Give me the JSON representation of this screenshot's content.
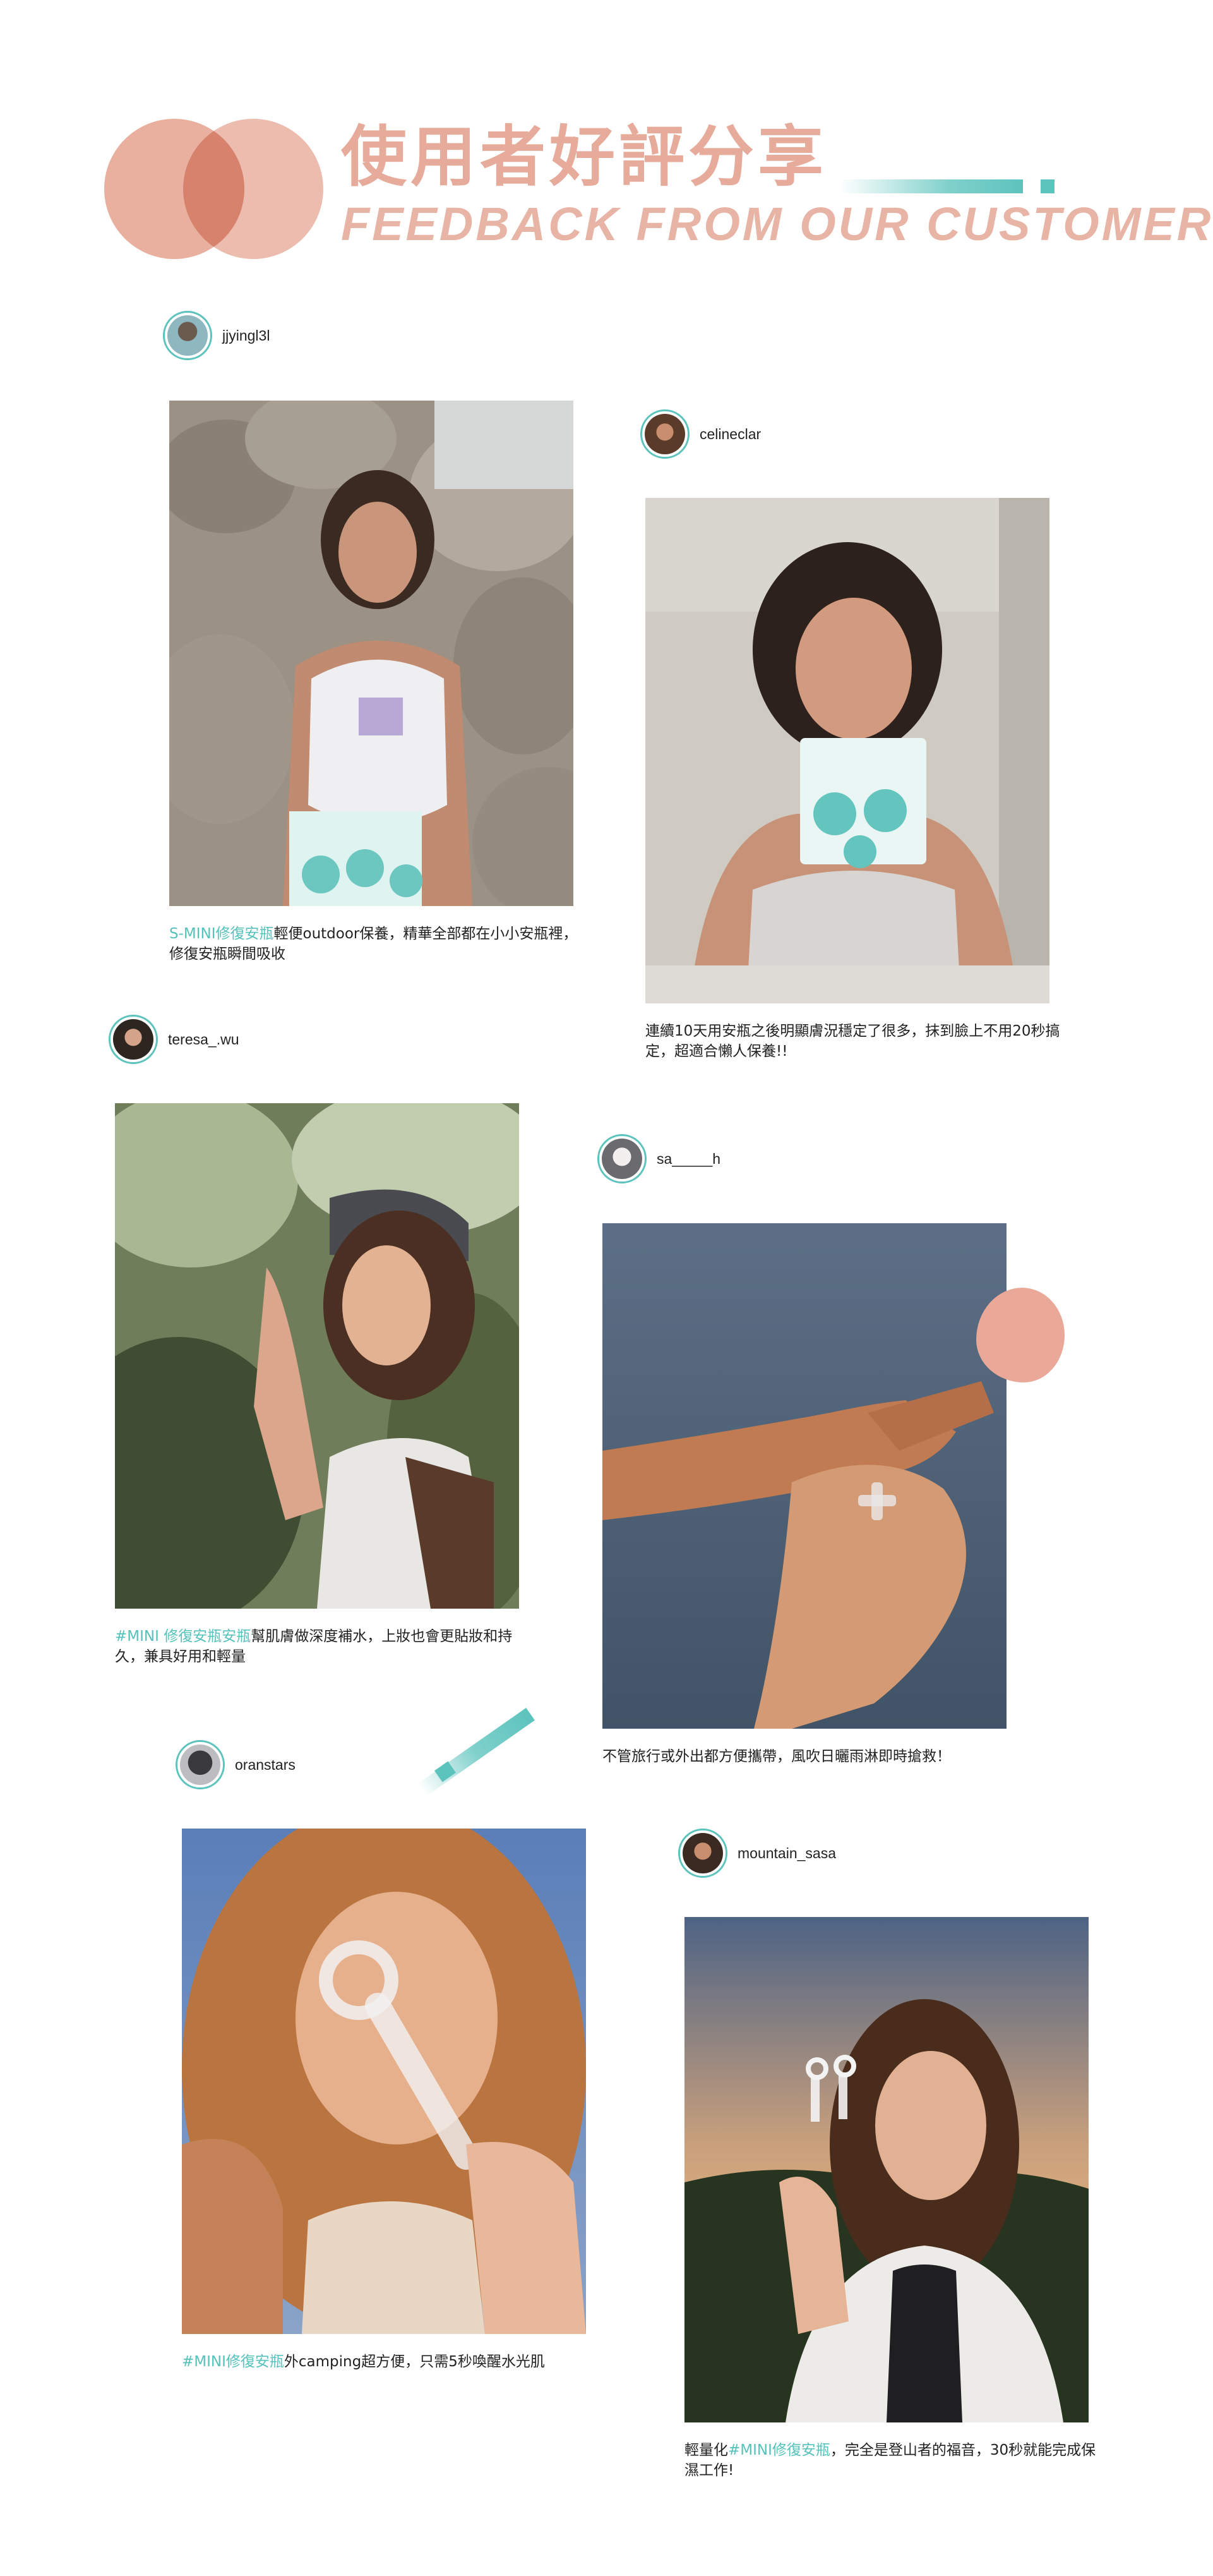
{
  "header": {
    "title_zh": "使用者好評分享",
    "title_en": "FEEDBACK FROM OUR CUSTOMER"
  },
  "colors": {
    "accent_pink": "#e6ab9a",
    "accent_teal": "#5dc3bd"
  },
  "posts": [
    {
      "username": "jjyingl3l",
      "caption_hl": "S-MINI修復安瓶",
      "caption_rest": "輕便outdoor保養，精華全部都在小小安瓶裡，修復安瓶瞬間吸收"
    },
    {
      "username": "celineclar",
      "caption_hl": "",
      "caption_rest": "連續10天用安瓶之後明顯膚況穩定了很多，抹到臉上不用20秒搞定，超適合懶人保養!!"
    },
    {
      "username": "teresa_.wu",
      "caption_hl": "#MINI 修復安瓶安瓶",
      "caption_rest": "幫肌膚做深度補水，上妝也會更貼妝和持久，兼具好用和輕量"
    },
    {
      "username": "sa_____h",
      "caption_hl": "",
      "caption_rest": "不管旅行或外出都方便攜帶，風吹日曬雨淋即時搶救！"
    },
    {
      "username": "oranstars",
      "caption_hl": "#MINI修復安瓶",
      "caption_rest": "外camping超方便，只需5秒喚醒水光肌"
    },
    {
      "username": "mountain_sasa",
      "caption_pre": "輕量化",
      "caption_hl": "#MINI修復安瓶",
      "caption_rest": "，完全是登山者的福音，30秒就能完成保濕工作!"
    }
  ]
}
